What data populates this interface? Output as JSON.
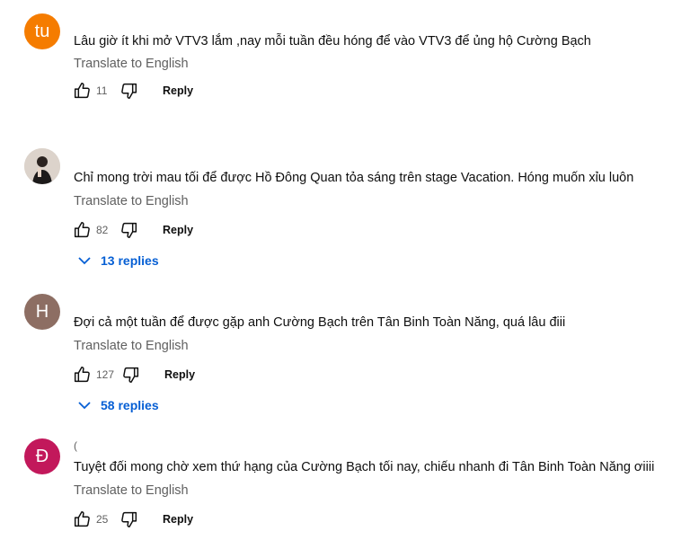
{
  "comments": [
    {
      "avatar_letter": "tu",
      "avatar_color": "#f57c00",
      "author": "",
      "text": "Lâu giờ ít khi mở VTV3 lắm ,nay mỗi tuần đều hóng để vào VTV3 để ủng hộ Cường Bạch",
      "translate": "Translate to English",
      "likes": "11",
      "reply_label": "Reply",
      "replies_label": ""
    },
    {
      "avatar_letter": "",
      "avatar_color": "#d8cfc6",
      "author": "",
      "text": "Chỉ mong trời mau tối để được Hồ Đông Quan tỏa sáng trên stage Vacation. Hóng muốn xỉu luôn",
      "translate": "Translate to English",
      "likes": "82",
      "reply_label": "Reply",
      "replies_label": "13 replies"
    },
    {
      "avatar_letter": "H",
      "avatar_color": "#8d6e63",
      "author": "",
      "text": "Đợi cả một tuần để được gặp anh Cường Bạch trên Tân Binh Toàn Năng, quá lâu điii",
      "translate": "Translate to English",
      "likes": "127",
      "reply_label": "Reply",
      "replies_label": "58 replies"
    },
    {
      "avatar_letter": "Đ",
      "avatar_color": "#c2185b",
      "author": "(",
      "text": "Tuyệt đối mong chờ xem thứ hạng của Cường Bạch tối nay, chiếu nhanh đi Tân Binh Toàn Năng ơiiii",
      "translate": "Translate to English",
      "likes": "25",
      "reply_label": "Reply",
      "replies_label": ""
    }
  ],
  "colors": {
    "link": "#065fd4",
    "muted": "#606060",
    "text": "#0f0f0f"
  },
  "icons": [
    "like-icon",
    "dislike-icon",
    "chevron-down-icon"
  ]
}
